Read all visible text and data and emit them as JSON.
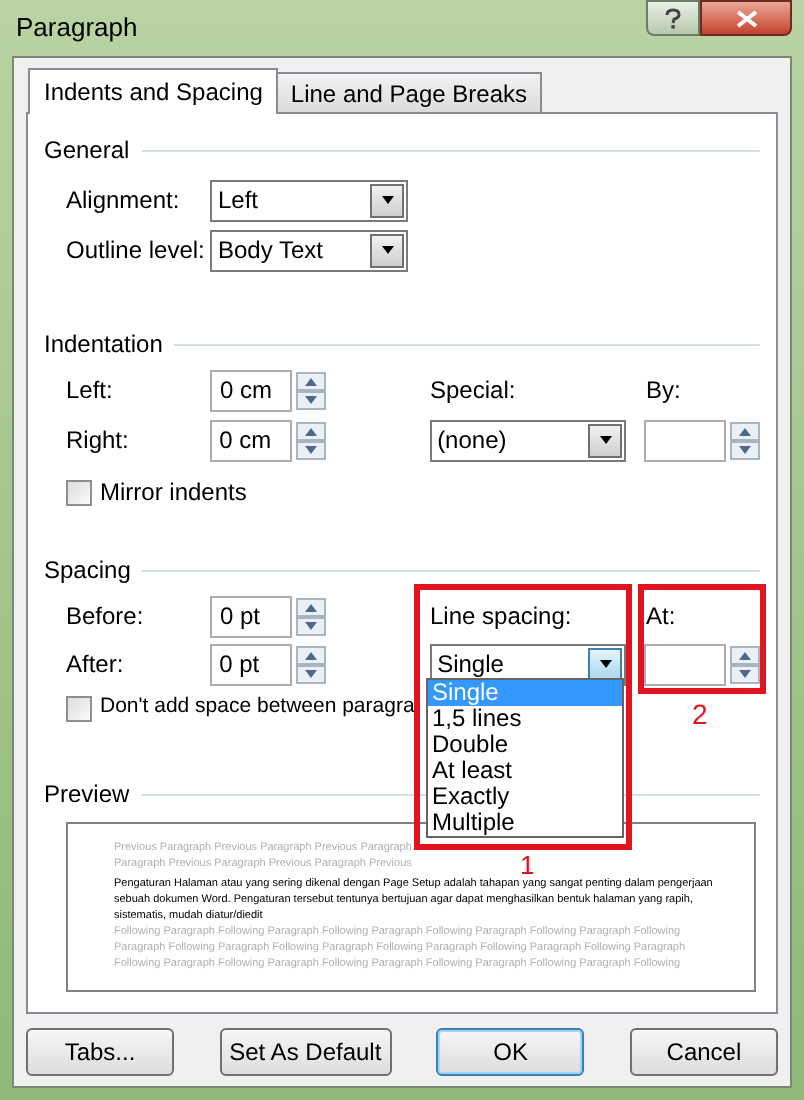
{
  "window": {
    "title": "Paragraph"
  },
  "tabs": [
    {
      "label": "Indents and Spacing",
      "selected": true
    },
    {
      "label": "Line and Page Breaks",
      "selected": false
    }
  ],
  "general": {
    "heading": "General",
    "alignment": {
      "label": "Alignment:",
      "value": "Left"
    },
    "outline_level": {
      "label": "Outline level:",
      "value": "Body Text"
    }
  },
  "indentation": {
    "heading": "Indentation",
    "left": {
      "label": "Left:",
      "value": "0 cm"
    },
    "right": {
      "label": "Right:",
      "value": "0 cm"
    },
    "special": {
      "label": "Special:",
      "value": "(none)"
    },
    "by": {
      "label": "By:"
    },
    "mirror_indents": {
      "label": "Mirror indents",
      "checked": false
    }
  },
  "spacing": {
    "heading": "Spacing",
    "before": {
      "label": "Before:",
      "value": "0 pt"
    },
    "after": {
      "label": "After:",
      "value": "0 pt"
    },
    "line_spacing": {
      "label": "Line spacing:",
      "value": "Single",
      "options": [
        {
          "label": "Single",
          "selected": true
        },
        {
          "label": "1,5 lines",
          "selected": false
        },
        {
          "label": "Double",
          "selected": false
        },
        {
          "label": "At least",
          "selected": false
        },
        {
          "label": "Exactly",
          "selected": false
        },
        {
          "label": "Multiple",
          "selected": false
        }
      ]
    },
    "at": {
      "label": "At:"
    },
    "dont_add_space": {
      "label": "Don't add space between paragra",
      "checked": false
    }
  },
  "preview": {
    "heading": "Preview",
    "previous_lines": [
      "Previous Paragraph Previous Paragraph Previous Paragraph",
      "Paragraph Previous Paragraph Previous Paragraph Previous"
    ],
    "sample": "Pengaturan Halaman atau yang sering dikenal dengan Page Setup adalah tahapan yang sangat penting dalam pengerjaan sebuah dokumen Word. Pengaturan tersebut tentunya bertujuan agar dapat menghasilkan bentuk halaman yang rapih, sistematis, mudah diatur/diedit",
    "following_lines": [
      "Following Paragraph Following Paragraph Following Paragraph Following Paragraph Following Paragraph Following",
      "Paragraph Following Paragraph Following Paragraph Following Paragraph Following Paragraph Following Paragraph",
      "Following Paragraph Following Paragraph Following Paragraph Following Paragraph Following Paragraph Following"
    ]
  },
  "buttons": [
    {
      "label": "Tabs...",
      "default": false
    },
    {
      "label": "Set As Default",
      "default": false
    },
    {
      "label": "OK",
      "default": true
    },
    {
      "label": "Cancel",
      "default": false
    }
  ],
  "annotations": [
    {
      "label": "1"
    },
    {
      "label": "2"
    }
  ]
}
